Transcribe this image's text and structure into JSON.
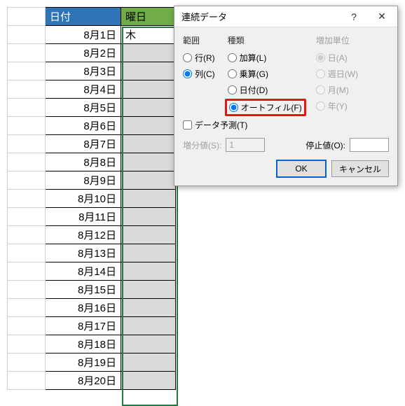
{
  "spreadsheet": {
    "header_a": "日付",
    "header_b": "曜日",
    "first_b_value": "木",
    "dates": [
      "8月1日",
      "8月2日",
      "8月3日",
      "8月4日",
      "8月5日",
      "8月6日",
      "8月7日",
      "8月8日",
      "8月9日",
      "8月10日",
      "8月11日",
      "8月12日",
      "8月13日",
      "8月14日",
      "8月15日",
      "8月16日",
      "8月17日",
      "8月18日",
      "8月19日",
      "8月20日"
    ]
  },
  "dialog": {
    "title": "連続データ",
    "help_symbol": "?",
    "close_symbol": "✕",
    "group_range_title": "範囲",
    "group_range_rows": "行(R)",
    "group_range_cols": "列(C)",
    "group_type_title": "種類",
    "group_type_add": "加算(L)",
    "group_type_mul": "乗算(G)",
    "group_type_date": "日付(D)",
    "group_type_autofill": "オートフィル(F)",
    "group_unit_title": "増加単位",
    "group_unit_day": "日(A)",
    "group_unit_weekday": "週日(W)",
    "group_unit_month": "月(M)",
    "group_unit_year": "年(Y)",
    "forecast_label": "データ予測(T)",
    "step_label": "増分値(S):",
    "step_value": "1",
    "stop_label": "停止値(O):",
    "stop_value": "",
    "ok": "OK",
    "cancel": "キャンセル"
  }
}
